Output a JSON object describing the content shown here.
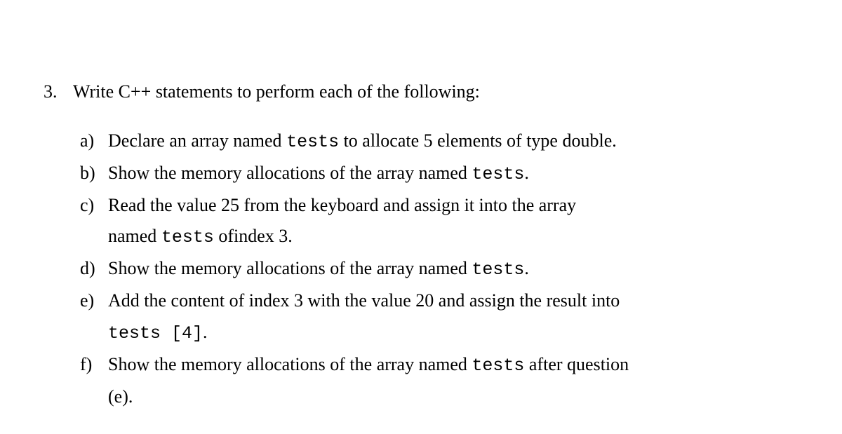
{
  "question": {
    "number": "3.",
    "text_before": "Write C++ statements to perform each of the following:",
    "items": {
      "a": {
        "label": "a)",
        "part1": "Declare an array named ",
        "code1": "tests",
        "part2": " to allocate 5 elements of type double."
      },
      "b": {
        "label": "b)",
        "part1": "Show the memory allocations of the array named ",
        "code1": "tests",
        "part2": "."
      },
      "c": {
        "label": "c)",
        "line1_part1": "Read the value 25 from the keyboard and assign it into the array",
        "line2_part1": "named ",
        "line2_code": "tests",
        "line2_part2": " ofindex 3."
      },
      "d": {
        "label": "d)",
        "part1": "Show the memory allocations of the array named ",
        "code1": "tests",
        "part2": "."
      },
      "e": {
        "label": "e)",
        "line1": "Add the content of index 3 with the value 20 and assign the result into",
        "line2_code": "tests [4]",
        "line2_part2": "."
      },
      "f": {
        "label": "f)",
        "line1_part1": "Show the memory allocations of the array named ",
        "line1_code": "tests",
        "line1_part2": "  after question",
        "line2": "(e)."
      }
    }
  }
}
